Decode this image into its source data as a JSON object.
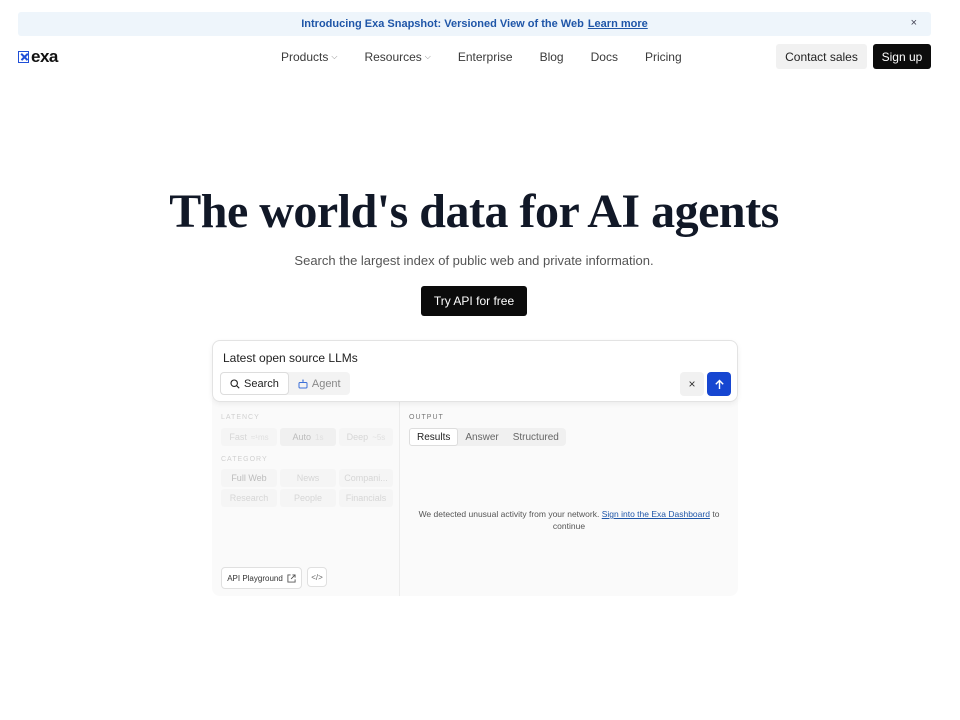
{
  "banner": {
    "message": "Introducing Exa Snapshot: Versioned View of the Web",
    "link": "Learn more",
    "close": "×"
  },
  "nav": {
    "logo": "exa",
    "items": [
      {
        "label": "Products",
        "dropdown": true
      },
      {
        "label": "Resources",
        "dropdown": true
      },
      {
        "label": "Enterprise",
        "dropdown": false
      },
      {
        "label": "Blog",
        "dropdown": false
      },
      {
        "label": "Docs",
        "dropdown": false
      },
      {
        "label": "Pricing",
        "dropdown": false
      }
    ],
    "contact": "Contact sales",
    "signup": "Sign up"
  },
  "hero": {
    "title": "The world's data for AI agents",
    "subtitle": "Search the largest index of public web and private information.",
    "cta": "Try API for free"
  },
  "search": {
    "query": "Latest open source LLMs",
    "modes": [
      "Search",
      "Agent"
    ],
    "clear": "×"
  },
  "options": {
    "latency_label": "LATENCY",
    "latency": [
      {
        "label": "Fast",
        "ms": "≈¹ms"
      },
      {
        "label": "Auto",
        "ms": "1s"
      },
      {
        "label": "Deep",
        "ms": "~5s"
      }
    ],
    "category_label": "CATEGORY",
    "categories": [
      "Full Web",
      "News",
      "Compani...",
      "Research",
      "People",
      "Financials"
    ],
    "playground": "API Playground",
    "code": "</>"
  },
  "output": {
    "label": "OUTPUT",
    "tabs": [
      "Results",
      "Answer",
      "Structured"
    ],
    "notice_pre": "We detected unusual activity from your network.",
    "notice_link": "Sign into the Exa Dashboard",
    "notice_post": "to continue"
  },
  "colors": {
    "accent": "#1646d1",
    "link": "#1f56a8",
    "banner_bg": "#eef5fb"
  }
}
